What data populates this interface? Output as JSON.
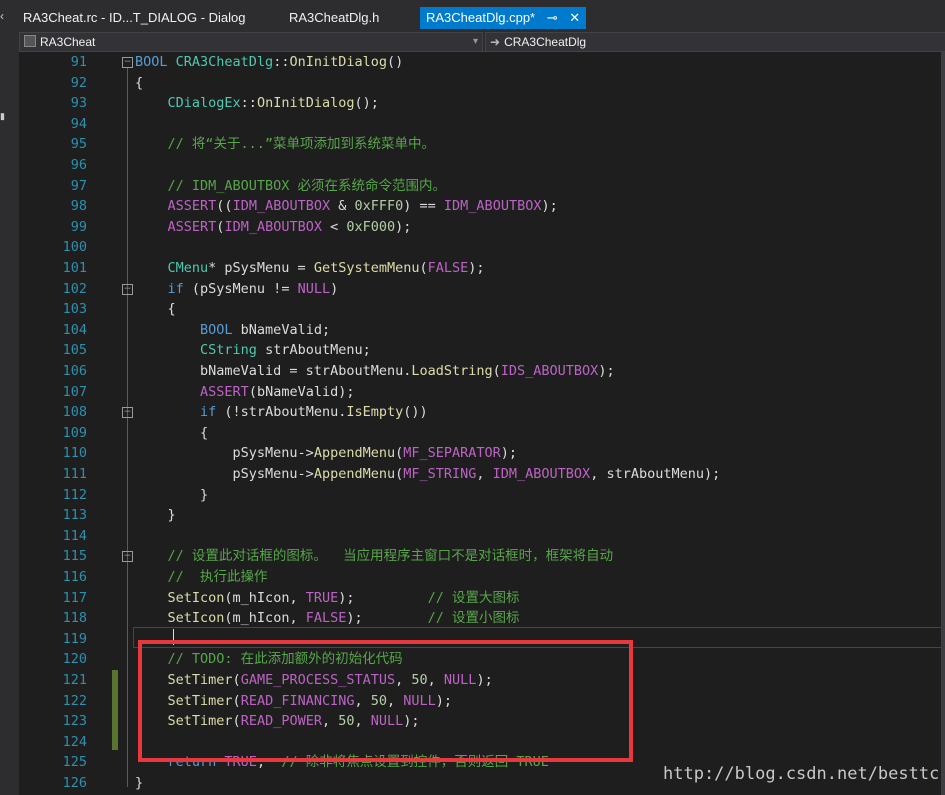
{
  "tabs": [
    {
      "label": "RA3Cheat.rc - ID...T_DIALOG - Dialog",
      "active": false
    },
    {
      "label": "RA3CheatDlg.h",
      "active": false
    },
    {
      "label": "RA3CheatDlg.cpp*",
      "active": true
    }
  ],
  "nav": {
    "project": "RA3Cheat",
    "scope": "CRA3CheatDlg"
  },
  "lines": [
    {
      "n": "91",
      "s": [
        [
          "kw",
          "BOOL"
        ],
        [
          "",
          " "
        ],
        [
          "ty",
          "CRA3CheatDlg"
        ],
        [
          "",
          "::"
        ],
        [
          "fn",
          "OnInitDialog"
        ],
        [
          "",
          "()"
        ]
      ]
    },
    {
      "n": "92",
      "s": [
        [
          "",
          "{"
        ]
      ]
    },
    {
      "n": "93",
      "s": [
        [
          "",
          "    "
        ],
        [
          "ty",
          "CDialogEx"
        ],
        [
          "",
          "::"
        ],
        [
          "fn",
          "OnInitDialog"
        ],
        [
          "",
          "();"
        ]
      ]
    },
    {
      "n": "94",
      "s": []
    },
    {
      "n": "95",
      "s": [
        [
          "",
          "    "
        ],
        [
          "cm",
          "// 将“关于...”菜单项添加到系统菜单中。"
        ]
      ]
    },
    {
      "n": "96",
      "s": []
    },
    {
      "n": "97",
      "s": [
        [
          "",
          "    "
        ],
        [
          "cm",
          "// IDM_ABOUTBOX 必须在系统命令范围内。"
        ]
      ]
    },
    {
      "n": "98",
      "s": [
        [
          "",
          "    "
        ],
        [
          "mac",
          "ASSERT"
        ],
        [
          "",
          "(("
        ],
        [
          "mac",
          "IDM_ABOUTBOX"
        ],
        [
          "",
          " & "
        ],
        [
          "nm",
          "0xFFF0"
        ],
        [
          "",
          ") == "
        ],
        [
          "mac",
          "IDM_ABOUTBOX"
        ],
        [
          "",
          ");"
        ]
      ]
    },
    {
      "n": "99",
      "s": [
        [
          "",
          "    "
        ],
        [
          "mac",
          "ASSERT"
        ],
        [
          "",
          "("
        ],
        [
          "mac",
          "IDM_ABOUTBOX"
        ],
        [
          "",
          " < "
        ],
        [
          "nm",
          "0xF000"
        ],
        [
          "",
          ");"
        ]
      ]
    },
    {
      "n": "100",
      "s": []
    },
    {
      "n": "101",
      "s": [
        [
          "",
          "    "
        ],
        [
          "ty",
          "CMenu"
        ],
        [
          "",
          "* pSysMenu = "
        ],
        [
          "fn",
          "GetSystemMenu"
        ],
        [
          "",
          "("
        ],
        [
          "mac",
          "FALSE"
        ],
        [
          "",
          ");"
        ]
      ]
    },
    {
      "n": "102",
      "s": [
        [
          "",
          "    "
        ],
        [
          "kw",
          "if"
        ],
        [
          "",
          " (pSysMenu != "
        ],
        [
          "mac",
          "NULL"
        ],
        [
          "",
          ")"
        ]
      ]
    },
    {
      "n": "103",
      "s": [
        [
          "",
          "    {"
        ]
      ]
    },
    {
      "n": "104",
      "s": [
        [
          "",
          "        "
        ],
        [
          "kw",
          "BOOL"
        ],
        [
          "",
          " bNameValid;"
        ]
      ]
    },
    {
      "n": "105",
      "s": [
        [
          "",
          "        "
        ],
        [
          "ty",
          "CString"
        ],
        [
          "",
          " strAboutMenu;"
        ]
      ]
    },
    {
      "n": "106",
      "s": [
        [
          "",
          "        bNameValid = strAboutMenu."
        ],
        [
          "fn",
          "LoadString"
        ],
        [
          "",
          "("
        ],
        [
          "mac",
          "IDS_ABOUTBOX"
        ],
        [
          "",
          ");"
        ]
      ]
    },
    {
      "n": "107",
      "s": [
        [
          "",
          "        "
        ],
        [
          "mac",
          "ASSERT"
        ],
        [
          "",
          "(bNameValid);"
        ]
      ]
    },
    {
      "n": "108",
      "s": [
        [
          "",
          "        "
        ],
        [
          "kw",
          "if"
        ],
        [
          "",
          " (!strAboutMenu."
        ],
        [
          "fn",
          "IsEmpty"
        ],
        [
          "",
          "())"
        ]
      ]
    },
    {
      "n": "109",
      "s": [
        [
          "",
          "        {"
        ]
      ]
    },
    {
      "n": "110",
      "s": [
        [
          "",
          "            pSysMenu->"
        ],
        [
          "fn",
          "AppendMenu"
        ],
        [
          "",
          "("
        ],
        [
          "mac",
          "MF_SEPARATOR"
        ],
        [
          "",
          ");"
        ]
      ]
    },
    {
      "n": "111",
      "s": [
        [
          "",
          "            pSysMenu->"
        ],
        [
          "fn",
          "AppendMenu"
        ],
        [
          "",
          "("
        ],
        [
          "mac",
          "MF_STRING"
        ],
        [
          "",
          ", "
        ],
        [
          "mac",
          "IDM_ABOUTBOX"
        ],
        [
          "",
          ", strAboutMenu);"
        ]
      ]
    },
    {
      "n": "112",
      "s": [
        [
          "",
          "        }"
        ]
      ]
    },
    {
      "n": "113",
      "s": [
        [
          "",
          "    }"
        ]
      ]
    },
    {
      "n": "114",
      "s": []
    },
    {
      "n": "115",
      "s": [
        [
          "",
          "    "
        ],
        [
          "cm",
          "// 设置此对话框的图标。  当应用程序主窗口不是对话框时，框架将自动"
        ]
      ]
    },
    {
      "n": "116",
      "s": [
        [
          "",
          "    "
        ],
        [
          "cm",
          "//  执行此操作"
        ]
      ]
    },
    {
      "n": "117",
      "s": [
        [
          "",
          "    "
        ],
        [
          "fn",
          "SetIcon"
        ],
        [
          "",
          "(m_hIcon, "
        ],
        [
          "mac",
          "TRUE"
        ],
        [
          "",
          ");         "
        ],
        [
          "cm",
          "// 设置大图标"
        ]
      ]
    },
    {
      "n": "118",
      "s": [
        [
          "",
          "    "
        ],
        [
          "fn",
          "SetIcon"
        ],
        [
          "",
          "(m_hIcon, "
        ],
        [
          "mac",
          "FALSE"
        ],
        [
          "",
          ");        "
        ],
        [
          "cm",
          "// 设置小图标"
        ]
      ]
    },
    {
      "n": "119",
      "s": []
    },
    {
      "n": "120",
      "s": [
        [
          "",
          "    "
        ],
        [
          "cm",
          "// TODO: 在此添加额外的初始化代码"
        ]
      ]
    },
    {
      "n": "121",
      "s": [
        [
          "",
          "    "
        ],
        [
          "fn",
          "SetTimer"
        ],
        [
          "",
          "("
        ],
        [
          "mac",
          "GAME_PROCESS_STATUS"
        ],
        [
          "",
          ", "
        ],
        [
          "nm",
          "50"
        ],
        [
          "",
          ", "
        ],
        [
          "mac",
          "NULL"
        ],
        [
          "",
          ");"
        ]
      ]
    },
    {
      "n": "122",
      "s": [
        [
          "",
          "    "
        ],
        [
          "fn",
          "SetTimer"
        ],
        [
          "",
          "("
        ],
        [
          "mac",
          "READ_FINANCING"
        ],
        [
          "",
          ", "
        ],
        [
          "nm",
          "50"
        ],
        [
          "",
          ", "
        ],
        [
          "mac",
          "NULL"
        ],
        [
          "",
          ");"
        ]
      ]
    },
    {
      "n": "123",
      "s": [
        [
          "",
          "    "
        ],
        [
          "fn",
          "SetTimer"
        ],
        [
          "",
          "("
        ],
        [
          "mac",
          "READ_POWER"
        ],
        [
          "",
          ", "
        ],
        [
          "nm",
          "50"
        ],
        [
          "",
          ", "
        ],
        [
          "mac",
          "NULL"
        ],
        [
          "",
          ");"
        ]
      ]
    },
    {
      "n": "124",
      "s": []
    },
    {
      "n": "125",
      "s": [
        [
          "",
          "    "
        ],
        [
          "kw",
          "return"
        ],
        [
          "",
          ""
        ],
        [
          "mac",
          " TRUE"
        ],
        [
          "",
          "; "
        ],
        [
          "cm",
          " // 除非将焦点设置到控件，否则返回 TRUE"
        ]
      ]
    },
    {
      "n": "126",
      "s": [
        [
          "",
          "}"
        ]
      ]
    }
  ],
  "watermark": "http://blog.csdn.net/besttc",
  "colors": {
    "accent": "#007acc",
    "highlight_box": "#e8383d",
    "change_bar": "#577430"
  }
}
